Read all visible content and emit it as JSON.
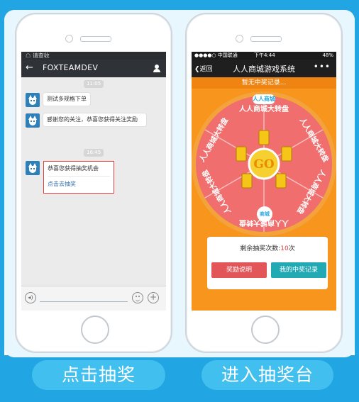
{
  "left_phone": {
    "status_text": "请查收",
    "nav": {
      "title": "FOXTEAMDEV"
    },
    "chat": {
      "time1": "11:05",
      "msg1": "测试多规格下单",
      "msg2": "感谢您的关注，恭喜您获得关注奖励",
      "time2": "16:45",
      "card_title": "恭喜您获得抽奖机会",
      "card_link": "点击去抽奖"
    }
  },
  "right_phone": {
    "status": {
      "carrier": "●●●●○ 中国联通",
      "clock": "下午4:44",
      "battery": "48%"
    },
    "nav": {
      "back": "返回",
      "title": "人人商城游戏系统",
      "more": "•••"
    },
    "ticker": "暂无中奖记录...",
    "logo_top": "人人商城",
    "wheel_labels": [
      "人人商城大转盘",
      "人人商城大转盘",
      "人人商城大转盘",
      "人人商城大转盘",
      "人人商城大转盘",
      "人人商城大转盘"
    ],
    "go_label": "GO",
    "logo_bottom": "商城",
    "remaining_prefix": "剩余抽奖次数:",
    "remaining_count": "10",
    "remaining_suffix": "次",
    "btn_rules": "奖励说明",
    "btn_records": "我的中奖记录"
  },
  "cta": {
    "left": "点击抽奖",
    "right": "进入抽奖台"
  },
  "colors": {
    "accent": "#22a6e3",
    "cta": "#41c0f0",
    "wheel": "#f06e6e",
    "orange": "#f7951d"
  }
}
